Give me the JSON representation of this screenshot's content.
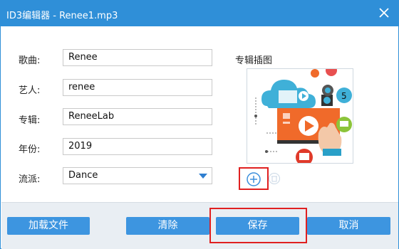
{
  "window": {
    "title": "ID3编辑器 - Renee1.mp3"
  },
  "fields": {
    "song": {
      "label": "歌曲:",
      "value": "Renee"
    },
    "artist": {
      "label": "艺人:",
      "value": "renee"
    },
    "album": {
      "label": "专辑:",
      "value": "ReneeLab"
    },
    "year": {
      "label": "年份:",
      "value": "2019"
    },
    "genre": {
      "label": "流派:",
      "value": "Dance"
    }
  },
  "album_art": {
    "label": "专辑插图"
  },
  "buttons": {
    "load_file": "加载文件",
    "clear": "清除",
    "save": "保存",
    "cancel": "取消"
  },
  "colors": {
    "accent": "#2f8fd8",
    "button": "#3d95e0",
    "highlight": "#e02020"
  }
}
